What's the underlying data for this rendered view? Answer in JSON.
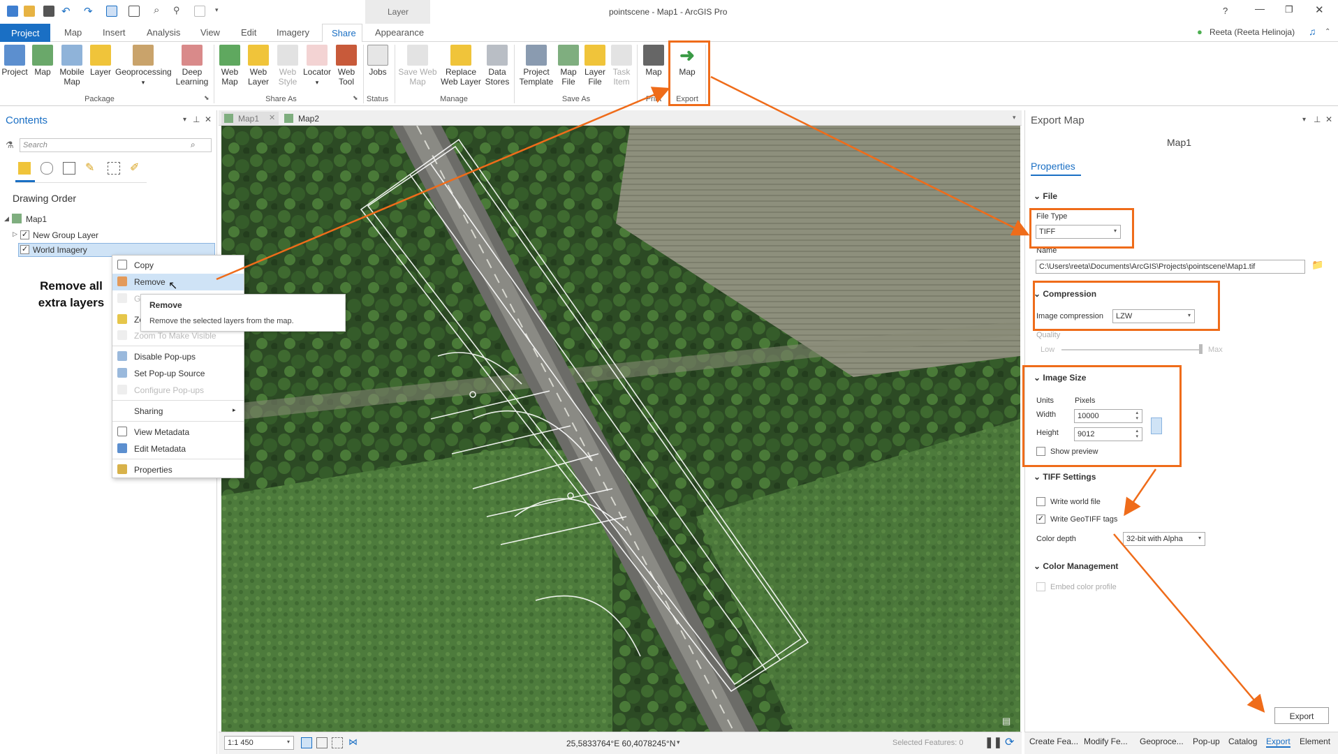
{
  "window": {
    "title": "pointscene - Map1 - ArcGIS Pro",
    "context_tab_group": "Layer",
    "help": "?",
    "user": "Reeta (Reeta Helinoja)"
  },
  "tabs": [
    "Project",
    "Map",
    "Insert",
    "Analysis",
    "View",
    "Edit",
    "Imagery",
    "Share",
    "Appearance"
  ],
  "ribbon": {
    "package": {
      "label": "Package",
      "items": [
        "Project",
        "Map",
        "Mobile Map",
        "Layer",
        "Geoprocessing",
        "Deep Learning"
      ]
    },
    "share_as": {
      "label": "Share As",
      "items": [
        "Web Map",
        "Web Layer",
        "Web Style",
        "Locator",
        "Web Tool"
      ]
    },
    "status": {
      "label": "Status",
      "items": [
        "Jobs"
      ]
    },
    "manage": {
      "label": "Manage",
      "items": [
        "Save Web Map",
        "Replace Web Layer",
        "Data Stores"
      ]
    },
    "save_as": {
      "label": "Save As",
      "items": [
        "Project Template",
        "Map File",
        "Layer File",
        "Task Item"
      ]
    },
    "print": {
      "label": "Print",
      "items": [
        "Map"
      ]
    },
    "export": {
      "label": "Export",
      "items": [
        "Map"
      ]
    }
  },
  "contents": {
    "title": "Contents",
    "search_placeholder": "Search",
    "drawing_order": "Drawing Order",
    "map": "Map1",
    "layers": [
      "New Group Layer",
      "World Imagery"
    ]
  },
  "annotation": {
    "line1": "Remove all",
    "line2": "extra layers"
  },
  "context_menu": {
    "items": [
      "Copy",
      "Remove",
      "Gr",
      "Zo",
      "Zoom To Make Visible",
      "Disable Pop-ups",
      "Set Pop-up Source",
      "Configure Pop-ups",
      "Sharing",
      "View Metadata",
      "Edit Metadata",
      "Properties"
    ]
  },
  "tooltip": {
    "title": "Remove",
    "text": "Remove the selected layers from the map."
  },
  "map_tabs": [
    "Map1",
    "Map2"
  ],
  "status": {
    "scale": "1:1 450",
    "coords": "25,5833764°E 60,4078245°N",
    "selected": "Selected Features: 0"
  },
  "export_pane": {
    "title": "Export Map",
    "map_name": "Map1",
    "properties": "Properties",
    "file": {
      "header": "File",
      "file_type_label": "File Type",
      "file_type": "TIFF",
      "name_label": "Name",
      "name": "C:\\Users\\reeta\\Documents\\ArcGIS\\Projects\\pointscene\\Map1.tif"
    },
    "compression": {
      "header": "Compression",
      "label": "Image compression",
      "value": "LZW",
      "quality_label": "Quality",
      "low": "Low",
      "max": "Max"
    },
    "image_size": {
      "header": "Image Size",
      "units_label": "Units",
      "units": "Pixels",
      "width_label": "Width",
      "width": "10000",
      "height_label": "Height",
      "height": "9012",
      "show_preview": "Show preview"
    },
    "tiff": {
      "header": "TIFF Settings",
      "world_file": "Write world file",
      "geotiff": "Write GeoTIFF tags",
      "color_depth_label": "Color depth",
      "color_depth": "32-bit with Alpha"
    },
    "color_mgmt": {
      "header": "Color Management",
      "embed": "Embed color profile"
    },
    "export_button": "Export"
  },
  "bottom_tabs": [
    "Create Fea...",
    "Modify Fe...",
    "Geoproce...",
    "Pop-up",
    "Catalog",
    "Export",
    "Element"
  ],
  "colors": {
    "accent": "#1a6fc4",
    "highlight": "#ef6c1a"
  }
}
